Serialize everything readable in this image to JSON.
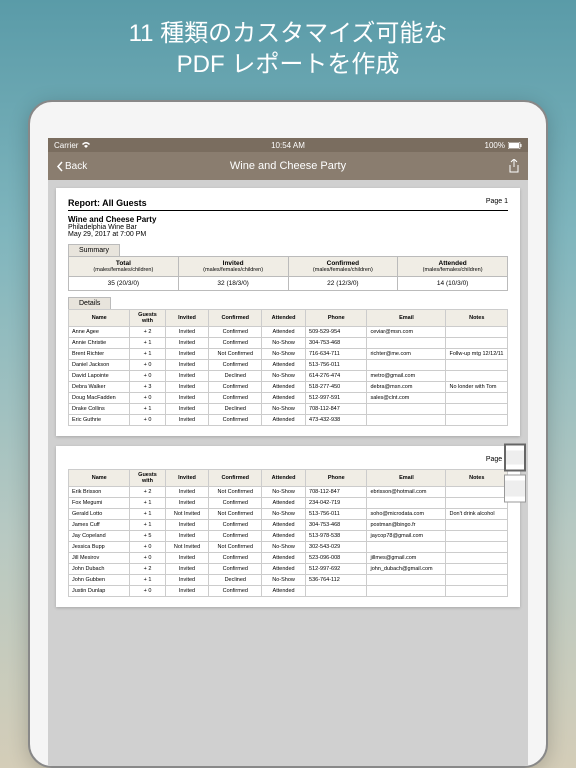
{
  "marketing": {
    "line1": "11 種類のカスタマイズ可能な",
    "line2": "PDF レポートを作成"
  },
  "statusBar": {
    "carrier": "Carrier",
    "time": "10:54 AM",
    "battery": "100%"
  },
  "nav": {
    "back": "Back",
    "title": "Wine and Cheese Party"
  },
  "report": {
    "title": "Report: All Guests",
    "page1": "Page 1",
    "page2": "Page 2",
    "eventName": "Wine and Cheese Party",
    "venue": "Philadelphia Wine Bar",
    "datetime": "May 29, 2017 at 7:00 PM",
    "summaryLabel": "Summary",
    "detailsLabel": "Details",
    "summaryHeaders": {
      "total": "Total",
      "invited": "Invited",
      "confirmed": "Confirmed",
      "attended": "Attended",
      "sub": "(males/females/children)"
    },
    "summaryValues": {
      "total": "35 (20/3/0)",
      "invited": "32 (18/3/0)",
      "confirmed": "22 (12/3/0)",
      "attended": "14 (10/3/0)"
    },
    "detailsHeaders": [
      "Name",
      "Guests with",
      "Invited",
      "Confirmed",
      "Attended",
      "Phone",
      "Email",
      "Notes"
    ],
    "rows1": [
      [
        "Anne Agee",
        "+ 2",
        "Invited",
        "Confirmed",
        "Attended",
        "509-529-954",
        "ceviar@msn.com",
        ""
      ],
      [
        "Annie Christie",
        "+ 1",
        "Invited",
        "Confirmed",
        "No-Show",
        "304-753-468",
        "",
        ""
      ],
      [
        "Brent Richter",
        "+ 1",
        "Invited",
        "Not Confirmed",
        "No-Show",
        "716-634-711",
        "richter@me.com",
        "Follw-up mtg 12/12/11"
      ],
      [
        "Daniel Jackson",
        "+ 0",
        "Invited",
        "Confirmed",
        "Attended",
        "513-756-011",
        "",
        ""
      ],
      [
        "David Lapointe",
        "+ 0",
        "Invited",
        "Declined",
        "No-Show",
        "614-276-474",
        "metro@gmail.com",
        ""
      ],
      [
        "Debra Walker",
        "+ 3",
        "Invited",
        "Confirmed",
        "Attended",
        "518-277-450",
        "debra@msn.com",
        "No londer with Tom"
      ],
      [
        "Doug MacFadden",
        "+ 0",
        "Invited",
        "Confirmed",
        "Attended",
        "512-997-591",
        "sales@clnt.com",
        ""
      ],
      [
        "Drake Collins",
        "+ 1",
        "Invited",
        "Declined",
        "No-Show",
        "708-112-847",
        "",
        ""
      ],
      [
        "Eric Guthrie",
        "+ 0",
        "Invited",
        "Confirmed",
        "Attended",
        "473-432-938",
        "",
        ""
      ]
    ],
    "rows2": [
      [
        "Erik Brisson",
        "+ 2",
        "Invited",
        "Not Confirmed",
        "No-Show",
        "708-112-847",
        "ebrisson@hotmail.com",
        ""
      ],
      [
        "Fox Megumi",
        "+ 1",
        "Invited",
        "Confirmed",
        "Attended",
        "234-042-719",
        "",
        ""
      ],
      [
        "Gerald Lotto",
        "+ 1",
        "Not Invited",
        "Not Confirmed",
        "No-Show",
        "513-756-011",
        "soho@microdata.com",
        "Don't drink alcohol"
      ],
      [
        "James Cuff",
        "+ 1",
        "Invited",
        "Confirmed",
        "Attended",
        "304-753-468",
        "postman@bingo.fr",
        ""
      ],
      [
        "Jay Copeland",
        "+ 5",
        "Invited",
        "Confirmed",
        "Attended",
        "513-978-538",
        "jaycop78@gmail.com",
        ""
      ],
      [
        "Jessica Bupp",
        "+ 0",
        "Not Invited",
        "Not Confirmed",
        "No-Show",
        "302-543-029",
        "",
        ""
      ],
      [
        "Jill Mesirov",
        "+ 0",
        "Invited",
        "Confirmed",
        "Attended",
        "523-096-008",
        "jillmes@gmail.com",
        ""
      ],
      [
        "John Dubach",
        "+ 2",
        "Invited",
        "Confirmed",
        "Attended",
        "512-997-692",
        "john_dubach@gmail.com",
        ""
      ],
      [
        "John Gubben",
        "+ 1",
        "Invited",
        "Declined",
        "No-Show",
        "536-764-112",
        "",
        ""
      ],
      [
        "Justin Dunlap",
        "+ 0",
        "Invited",
        "Confirmed",
        "Attended",
        "",
        "",
        ""
      ]
    ]
  }
}
